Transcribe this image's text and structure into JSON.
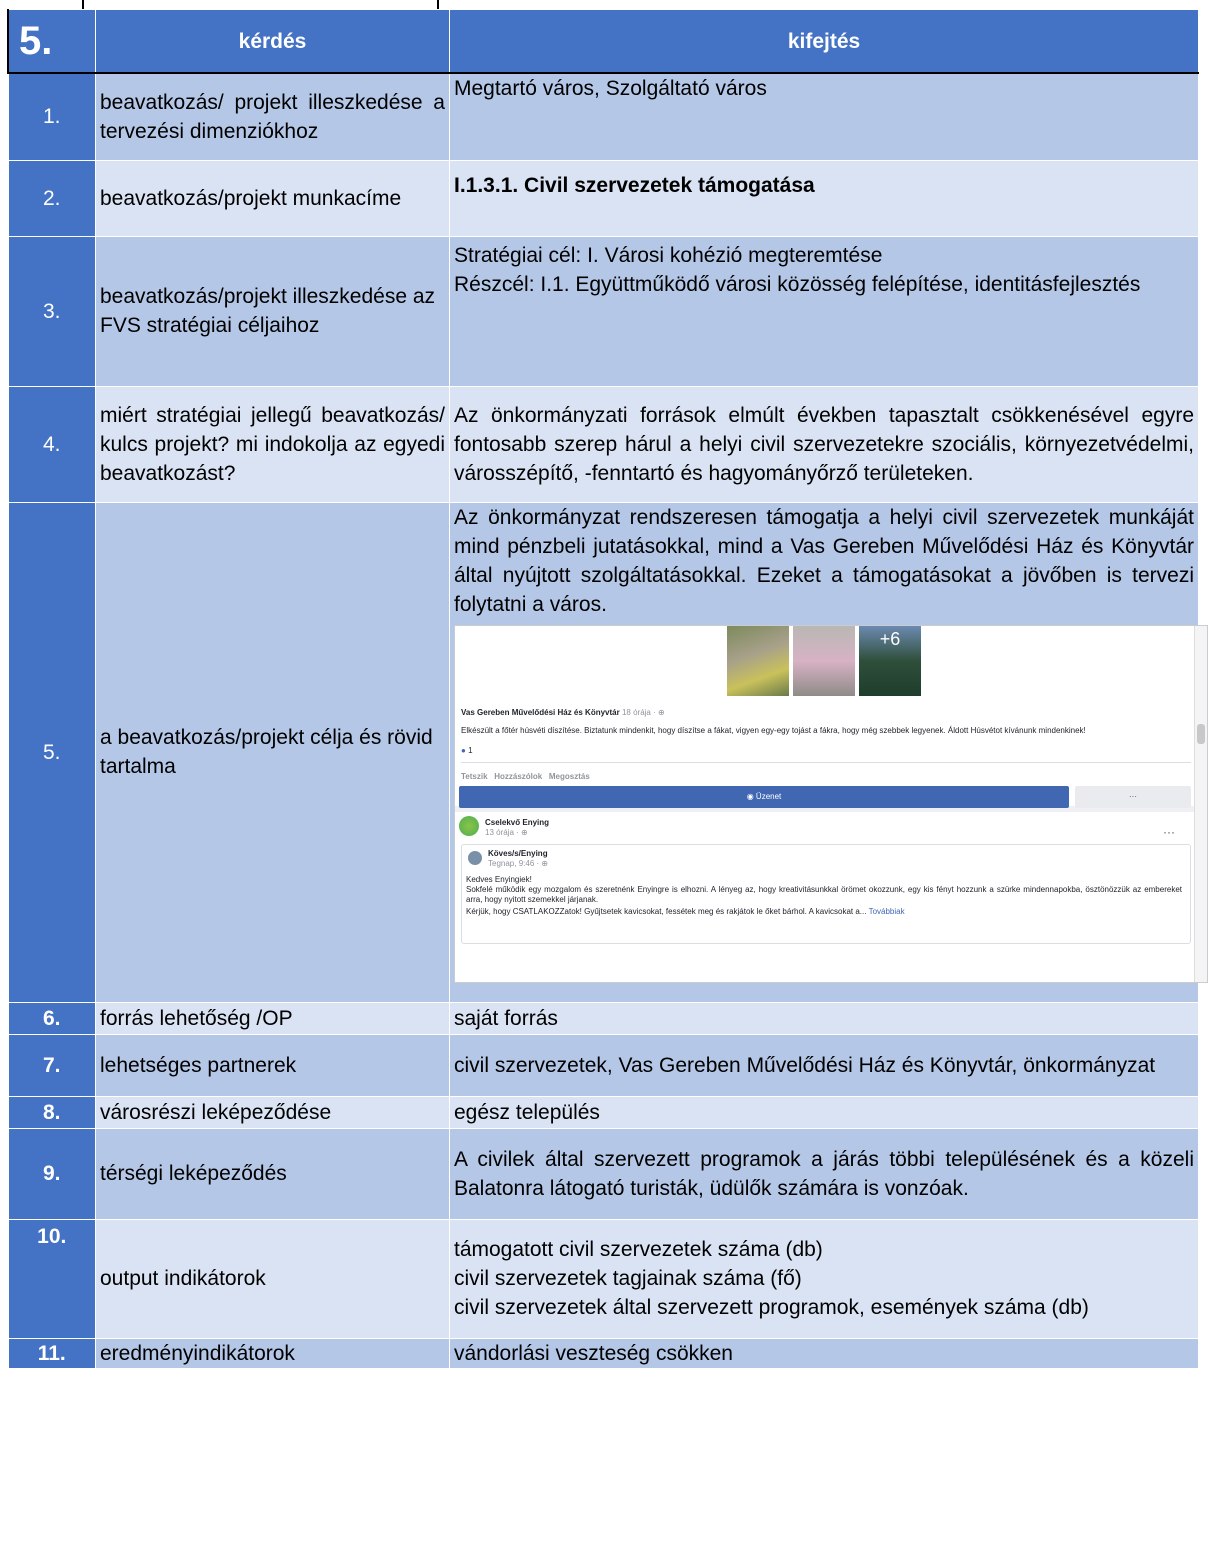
{
  "header": {
    "number": "5.",
    "col_question": "kérdés",
    "col_answer": "kifejtés"
  },
  "rows": [
    {
      "num": "1.",
      "question": "beavatkozás/ projekt illeszkedése a tervezési dimenziókhoz",
      "answer": "Megtartó város, Szolgáltató város"
    },
    {
      "num": "2.",
      "question": "beavatkozás/projekt munkacíme",
      "answer": "I.1.3.1. Civil szervezetek támogatása"
    },
    {
      "num": "3.",
      "question": "beavatkozás/projekt illeszkedése az FVS stratégiai céljaihoz",
      "answer_line1": "Stratégiai cél: I. Városi kohézió megteremtése",
      "answer_line2": "Részcél: I.1. Együttműködő városi közösség felépítése, identitásfejlesztés"
    },
    {
      "num": "4.",
      "question": "miért stratégiai jellegű beavatkozás/ kulcs projekt? mi indokolja az egyedi beavatkozást?",
      "answer": "Az önkormányzati források elmúlt években tapasztalt csökkenésével egyre fontosabb szerep hárul a helyi civil szervezetekre szociális, környezetvédelmi, városszépítő, -fenntartó és hagyományőrző területeken."
    },
    {
      "num": "5.",
      "question": "a beavatkozás/projekt célja és rövid tartalma",
      "answer": "Az önkormányzat rendszeresen támogatja a helyi civil szervezetek munkáját mind pénzbeli jutatásokkal, mind a Vas Gereben Művelődési Ház és Könyvtár által nyújtott szolgáltatásokkal. Ezeket a támogatásokat a jövőben is tervezi folytatni a város."
    },
    {
      "num": "6.",
      "question": "forrás lehetőség /OP",
      "answer": "saját forrás"
    },
    {
      "num": "7.",
      "question": "lehetséges partnerek",
      "answer": "civil szervezetek, Vas Gereben Művelődési Ház és Könyvtár, önkormányzat"
    },
    {
      "num": "8.",
      "question": "városrészi leképeződése",
      "answer": "egész település"
    },
    {
      "num": "9.",
      "question": "térségi leképeződés",
      "answer": " A civilek által szervezett programok a járás többi településének és a közeli Balatonra látogató turisták, üdülők számára is vonzóak."
    },
    {
      "num": "10.",
      "question": "output indikátorok",
      "answer_line1": "támogatott civil szervezetek száma (db)",
      "answer_line2": "civil szervezetek tagjainak száma (fő)",
      "answer_line3": "civil szervezetek által szervezett programok, események száma (db)"
    },
    {
      "num": "11.",
      "question": "eredményindikátorok",
      "answer": "vándorlási veszteség csökken"
    }
  ],
  "screenshot": {
    "photo_more": "+6",
    "post1_author": "Vas Gereben Művelődési Ház és Könyvtár",
    "post1_time": "18 órája · ⊕",
    "post1_text": "Elkészült a főtér húsvéti díszítése. Biztatunk mindenkit, hogy díszítse a fákat, vigyen egy-egy tojást a fákra, hogy még szebbek legyenek. Áldott Húsvétot kívánunk mindenkinek!",
    "likes": "1",
    "action_like": "Tetszik",
    "action_comment": "Hozzászólok",
    "action_share": "Megosztás",
    "post2_author": "Cselekvő Enying",
    "post2_time": "13 órája · ⊕",
    "shared_author": "Köves/s/Enying",
    "shared_time": "Tegnap, 9:46 · ⊕",
    "shared_text1": "Kedves Enyingiek!",
    "shared_text2": "Sokfelé működik egy mozgalom és szeretnénk Enyingre is elhozni. A lényeg az, hogy kreativitásunkkal örömet okozzunk, egy kis fényt hozzunk a szürke mindennapokba, ösztönözzük az embereket arra, hogy nyitott szemekkel járjanak.",
    "shared_text3": "Kérjük, hogy CSATLAKOZZatok! Gyűjtsetek kavicsokat, fessétek meg és rakjátok le őket bárhol. A kavicsokat a...",
    "more_link": "Továbbiak",
    "message_button": "Üzenet",
    "more_button": "···",
    "options": "···"
  },
  "colors": {
    "dark": "#4472c4",
    "mid": "#b4c7e7",
    "light": "#dae3f3"
  }
}
